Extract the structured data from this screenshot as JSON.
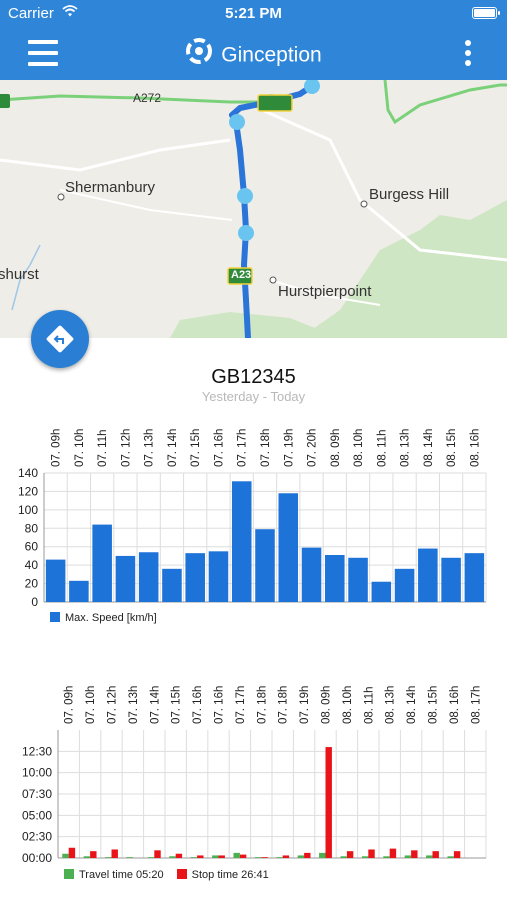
{
  "status_bar": {
    "carrier": "Carrier",
    "time": "5:21 PM"
  },
  "nav": {
    "title": "Ginception"
  },
  "map": {
    "labels": {
      "a272": "A272",
      "shermanbury": "Shermanbury",
      "burgess_hill": "Burgess Hill",
      "a23": "A23",
      "hurstpierpoint": "Hurstpierpoint",
      "hurst": "shurst"
    }
  },
  "vehicle": {
    "plate": "GB12345",
    "range": "Yesterday - Today"
  },
  "colors": {
    "accent": "#2f86d8",
    "speed_bar": "#1e73d8",
    "travel": "#4caf50",
    "stop": "#e8141a",
    "route": "#2b74d8"
  },
  "chart_data": [
    {
      "type": "bar",
      "categories": [
        "07. 09h",
        "07. 10h",
        "07. 11h",
        "07. 12h",
        "07. 13h",
        "07. 14h",
        "07. 15h",
        "07. 16h",
        "07. 17h",
        "07. 18h",
        "07. 19h",
        "07. 20h",
        "08. 09h",
        "08. 10h",
        "08. 11h",
        "08. 13h",
        "08. 14h",
        "08. 15h",
        "08. 16h"
      ],
      "series": [
        {
          "name": "Max. Speed [km/h]",
          "values": [
            46,
            23,
            84,
            50,
            54,
            36,
            53,
            55,
            131,
            79,
            118,
            59,
            51,
            48,
            22,
            36,
            58,
            48,
            53
          ]
        }
      ],
      "yticks": [
        0,
        20,
        40,
        60,
        80,
        100,
        120,
        140
      ],
      "ylim": [
        0,
        140
      ],
      "legend": "bottom-left",
      "grid": true
    },
    {
      "type": "bar",
      "categories": [
        "07. 09h",
        "07. 10h",
        "07. 12h",
        "07. 13h",
        "07. 14h",
        "07. 15h",
        "07. 16h",
        "07. 16h",
        "07. 17h",
        "07. 18h",
        "07. 18h",
        "07. 19h",
        "08. 09h",
        "08. 10h",
        "08. 11h",
        "08. 13h",
        "08. 14h",
        "08. 15h",
        "08. 16h",
        "08. 17h"
      ],
      "series": [
        {
          "name": "Travel time 05:20",
          "values": [
            0.5,
            0.2,
            0.1,
            0.1,
            0.1,
            0.2,
            0.1,
            0.3,
            0.6,
            0.1,
            0.1,
            0.3,
            0.6,
            0.2,
            0.2,
            0.2,
            0.3,
            0.3,
            0.2,
            0.0
          ]
        },
        {
          "name": "Stop time 26:41",
          "values": [
            1.2,
            0.8,
            1.0,
            0.0,
            0.9,
            0.5,
            0.3,
            0.3,
            0.4,
            0.1,
            0.3,
            0.6,
            13.0,
            0.8,
            1.0,
            1.1,
            0.9,
            0.8,
            0.8,
            0.0
          ]
        }
      ],
      "yticks": [
        "00:00",
        "02:30",
        "05:00",
        "07:30",
        "10:00",
        "12:30"
      ],
      "ylim": [
        0,
        15
      ],
      "legend": "bottom-left",
      "grid": true
    }
  ]
}
